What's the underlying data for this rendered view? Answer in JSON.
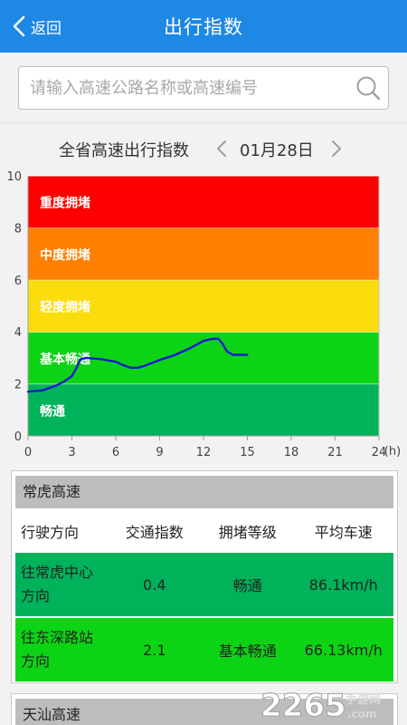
{
  "header": {
    "back_label": "返回",
    "title": "出行指数"
  },
  "search": {
    "placeholder": "请输入高速公路名称或高速编号"
  },
  "chart_header": {
    "title": "全省高速出行指数",
    "date": "01月28日"
  },
  "chart_data": {
    "type": "line",
    "x_unit": "(h)",
    "xlim": [
      0,
      24
    ],
    "ylim": [
      0,
      10
    ],
    "x_ticks": [
      0,
      3,
      6,
      9,
      12,
      15,
      18,
      21,
      24
    ],
    "y_ticks": [
      0,
      2,
      4,
      6,
      8,
      10
    ],
    "bands": [
      {
        "label": "畅通",
        "from": 0,
        "to": 2,
        "color": "#00b25a"
      },
      {
        "label": "基本畅通",
        "from": 2,
        "to": 4,
        "color": "#0cd414"
      },
      {
        "label": "轻度拥堵",
        "from": 4,
        "to": 6,
        "color": "#fbdd0d"
      },
      {
        "label": "中度拥堵",
        "from": 6,
        "to": 8,
        "color": "#ff7f00"
      },
      {
        "label": "重度拥堵",
        "from": 8,
        "to": 10,
        "color": "#ff0000"
      }
    ],
    "series": [
      {
        "color": "#1a1acc",
        "x": [
          0,
          1,
          1.5,
          2,
          2.5,
          3,
          3.3,
          3.6,
          4,
          5,
          6,
          6.5,
          7,
          7.5,
          8,
          9,
          10,
          11,
          11.5,
          12,
          12.5,
          13,
          13.3,
          13.6,
          14,
          14.5,
          15
        ],
        "y": [
          1.7,
          1.75,
          1.85,
          1.95,
          2.1,
          2.3,
          2.6,
          2.95,
          3.0,
          2.95,
          2.85,
          2.72,
          2.62,
          2.62,
          2.7,
          2.92,
          3.1,
          3.35,
          3.5,
          3.65,
          3.72,
          3.74,
          3.55,
          3.25,
          3.12,
          3.12,
          3.12
        ]
      }
    ]
  },
  "table": {
    "columns": [
      "行驶方向",
      "交通指数",
      "拥堵等级",
      "平均车速"
    ],
    "cards": [
      {
        "name": "常虎高速",
        "rows": [
          {
            "direction": "往常虎中心方向",
            "index": "0.4",
            "level": "畅通",
            "speed": "86.1km/h",
            "color": "#00b25a"
          },
          {
            "direction": "往东深路站方向",
            "index": "2.1",
            "level": "基本畅通",
            "speed": "66.13km/h",
            "color": "#0cd414"
          }
        ]
      },
      {
        "name": "天汕高速"
      }
    ]
  },
  "watermark": {
    "text": "2265",
    "sub": ".com",
    "tag": "手游网"
  }
}
